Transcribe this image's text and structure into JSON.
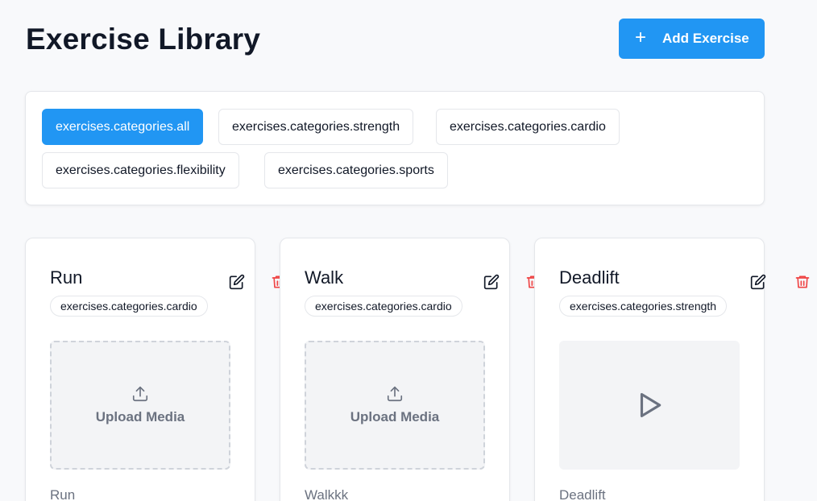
{
  "header": {
    "title": "Exercise Library",
    "add_button_label": "Add Exercise"
  },
  "filters": [
    {
      "label": "exercises.categories.all",
      "active": true
    },
    {
      "label": "exercises.categories.strength",
      "active": false
    },
    {
      "label": "exercises.categories.cardio",
      "active": false
    },
    {
      "label": "exercises.categories.flexibility",
      "active": false
    },
    {
      "label": "exercises.categories.sports",
      "active": false
    }
  ],
  "exercises": [
    {
      "name": "Run",
      "category": "exercises.categories.cardio",
      "media": "upload",
      "upload_label": "Upload Media",
      "description": "Run"
    },
    {
      "name": "Walk",
      "category": "exercises.categories.cardio",
      "media": "upload",
      "upload_label": "Upload Media",
      "description": "Walkkk"
    },
    {
      "name": "Deadlift",
      "category": "exercises.categories.strength",
      "media": "video",
      "description": "Deadlift"
    }
  ],
  "icons": {
    "add": "plus-icon",
    "edit": "edit-icon",
    "delete": "trash-icon",
    "upload": "upload-icon",
    "play": "play-icon"
  },
  "colors": {
    "accent": "#2196f3",
    "delete": "#ef4444",
    "muted_text": "#6b7280",
    "page_background": "#f8f9fb"
  }
}
